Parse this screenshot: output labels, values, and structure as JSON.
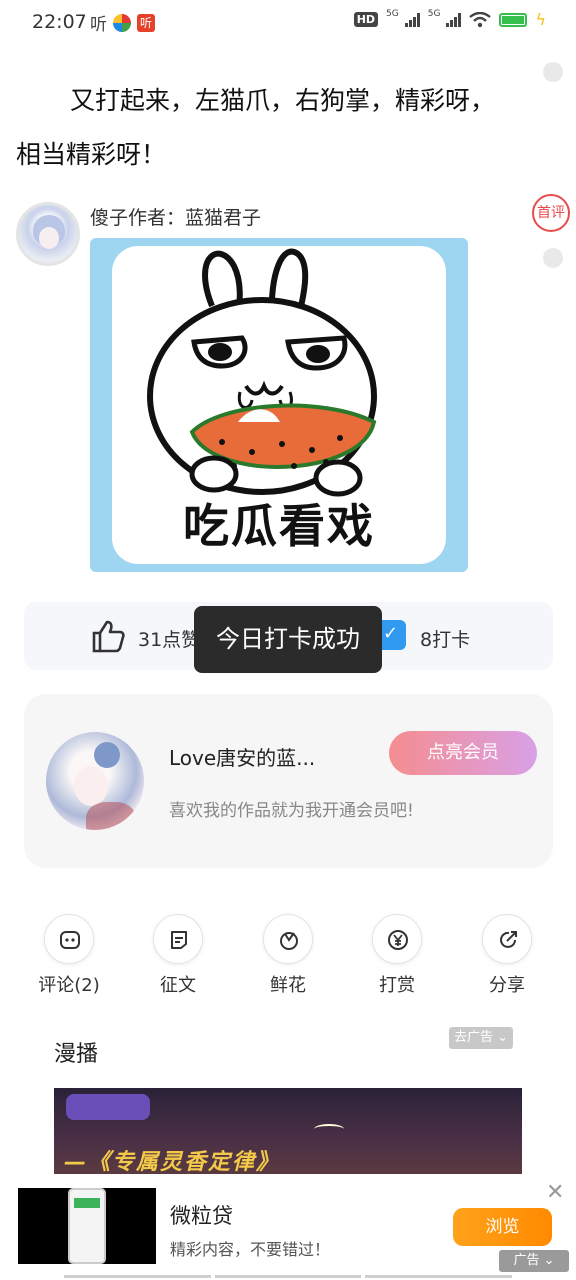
{
  "status_bar": {
    "time": "22:07",
    "listen_label": "听",
    "app_badge": "听",
    "hd": "HD",
    "net1": "5G",
    "net2": "5G"
  },
  "story": {
    "text": "又打起来，左猫爪，右狗掌，精彩呀，相当精彩呀！"
  },
  "first_comment_badge": "首评",
  "author": {
    "line": "傻子作者：蓝猫君子"
  },
  "sticker": {
    "caption": "吃瓜看戏"
  },
  "action_bar": {
    "like_text": "31点赞",
    "checkin_text": "8打卡"
  },
  "toast": {
    "text": "今日打卡成功"
  },
  "member_card": {
    "name": "Love唐安的蓝...",
    "subtitle": "喜欢我的作品就为我开通会员吧!",
    "button": "点亮会员"
  },
  "actions": [
    {
      "label": "评论(2)",
      "icon": "comment-icon"
    },
    {
      "label": "征文",
      "icon": "essay-icon"
    },
    {
      "label": "鲜花",
      "icon": "flower-icon"
    },
    {
      "label": "打赏",
      "icon": "yuan-icon"
    },
    {
      "label": "分享",
      "icon": "share-icon"
    }
  ],
  "manbo": {
    "title": "漫播",
    "ad_tag": "去广告 ⌄",
    "video_text": "—《专属灵香定律》"
  },
  "bottom_ad": {
    "title": "微粒贷",
    "subtitle": "精彩内容，不要错过！",
    "button": "浏览",
    "label": "广告 ⌄"
  },
  "colors": {
    "accent_red": "#e84b4b",
    "checkin_blue": "#2f9af0",
    "sticker_bg": "#9ed6f2",
    "ad_orange": "#ff8a00"
  }
}
